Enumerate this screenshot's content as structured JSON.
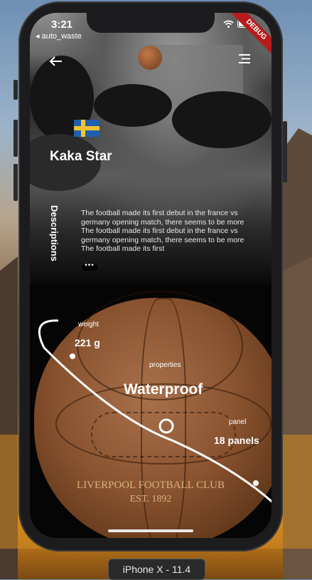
{
  "simulator": {
    "device_label": "iPhone X - 11.4"
  },
  "status_bar": {
    "time": "3:21",
    "back_app": "◂ auto_waste",
    "debug_banner": "DEBUG"
  },
  "header": {
    "back_icon": "back-arrow-icon",
    "menu_icon": "menu-icon",
    "logo_icon": "ball-logo-icon"
  },
  "player": {
    "flag_icon": "sweden-flag-icon",
    "name": "Kaka Star",
    "descriptions_tab": "Descriptions",
    "description": "The football made its first debut in the france vs germany opening match, there seems to be more The football made its first debut in the france vs germany opening match, there seems to be more The football made its first",
    "more_label": "•••"
  },
  "ball": {
    "club_line1": "LIVERPOOL FOOTBALL CLUB",
    "club_line2": "EST. 1892"
  },
  "properties": {
    "weight_label": "weight",
    "weight_value": "221 g",
    "props_label": "properties",
    "props_value": "Waterproof",
    "panel_label": "panel",
    "panel_value": "18 panels"
  },
  "colors": {
    "debug": "#b71c1c",
    "leather": "#8a5330",
    "flag_blue": "#1f5fae",
    "flag_yellow": "#f2c230"
  }
}
